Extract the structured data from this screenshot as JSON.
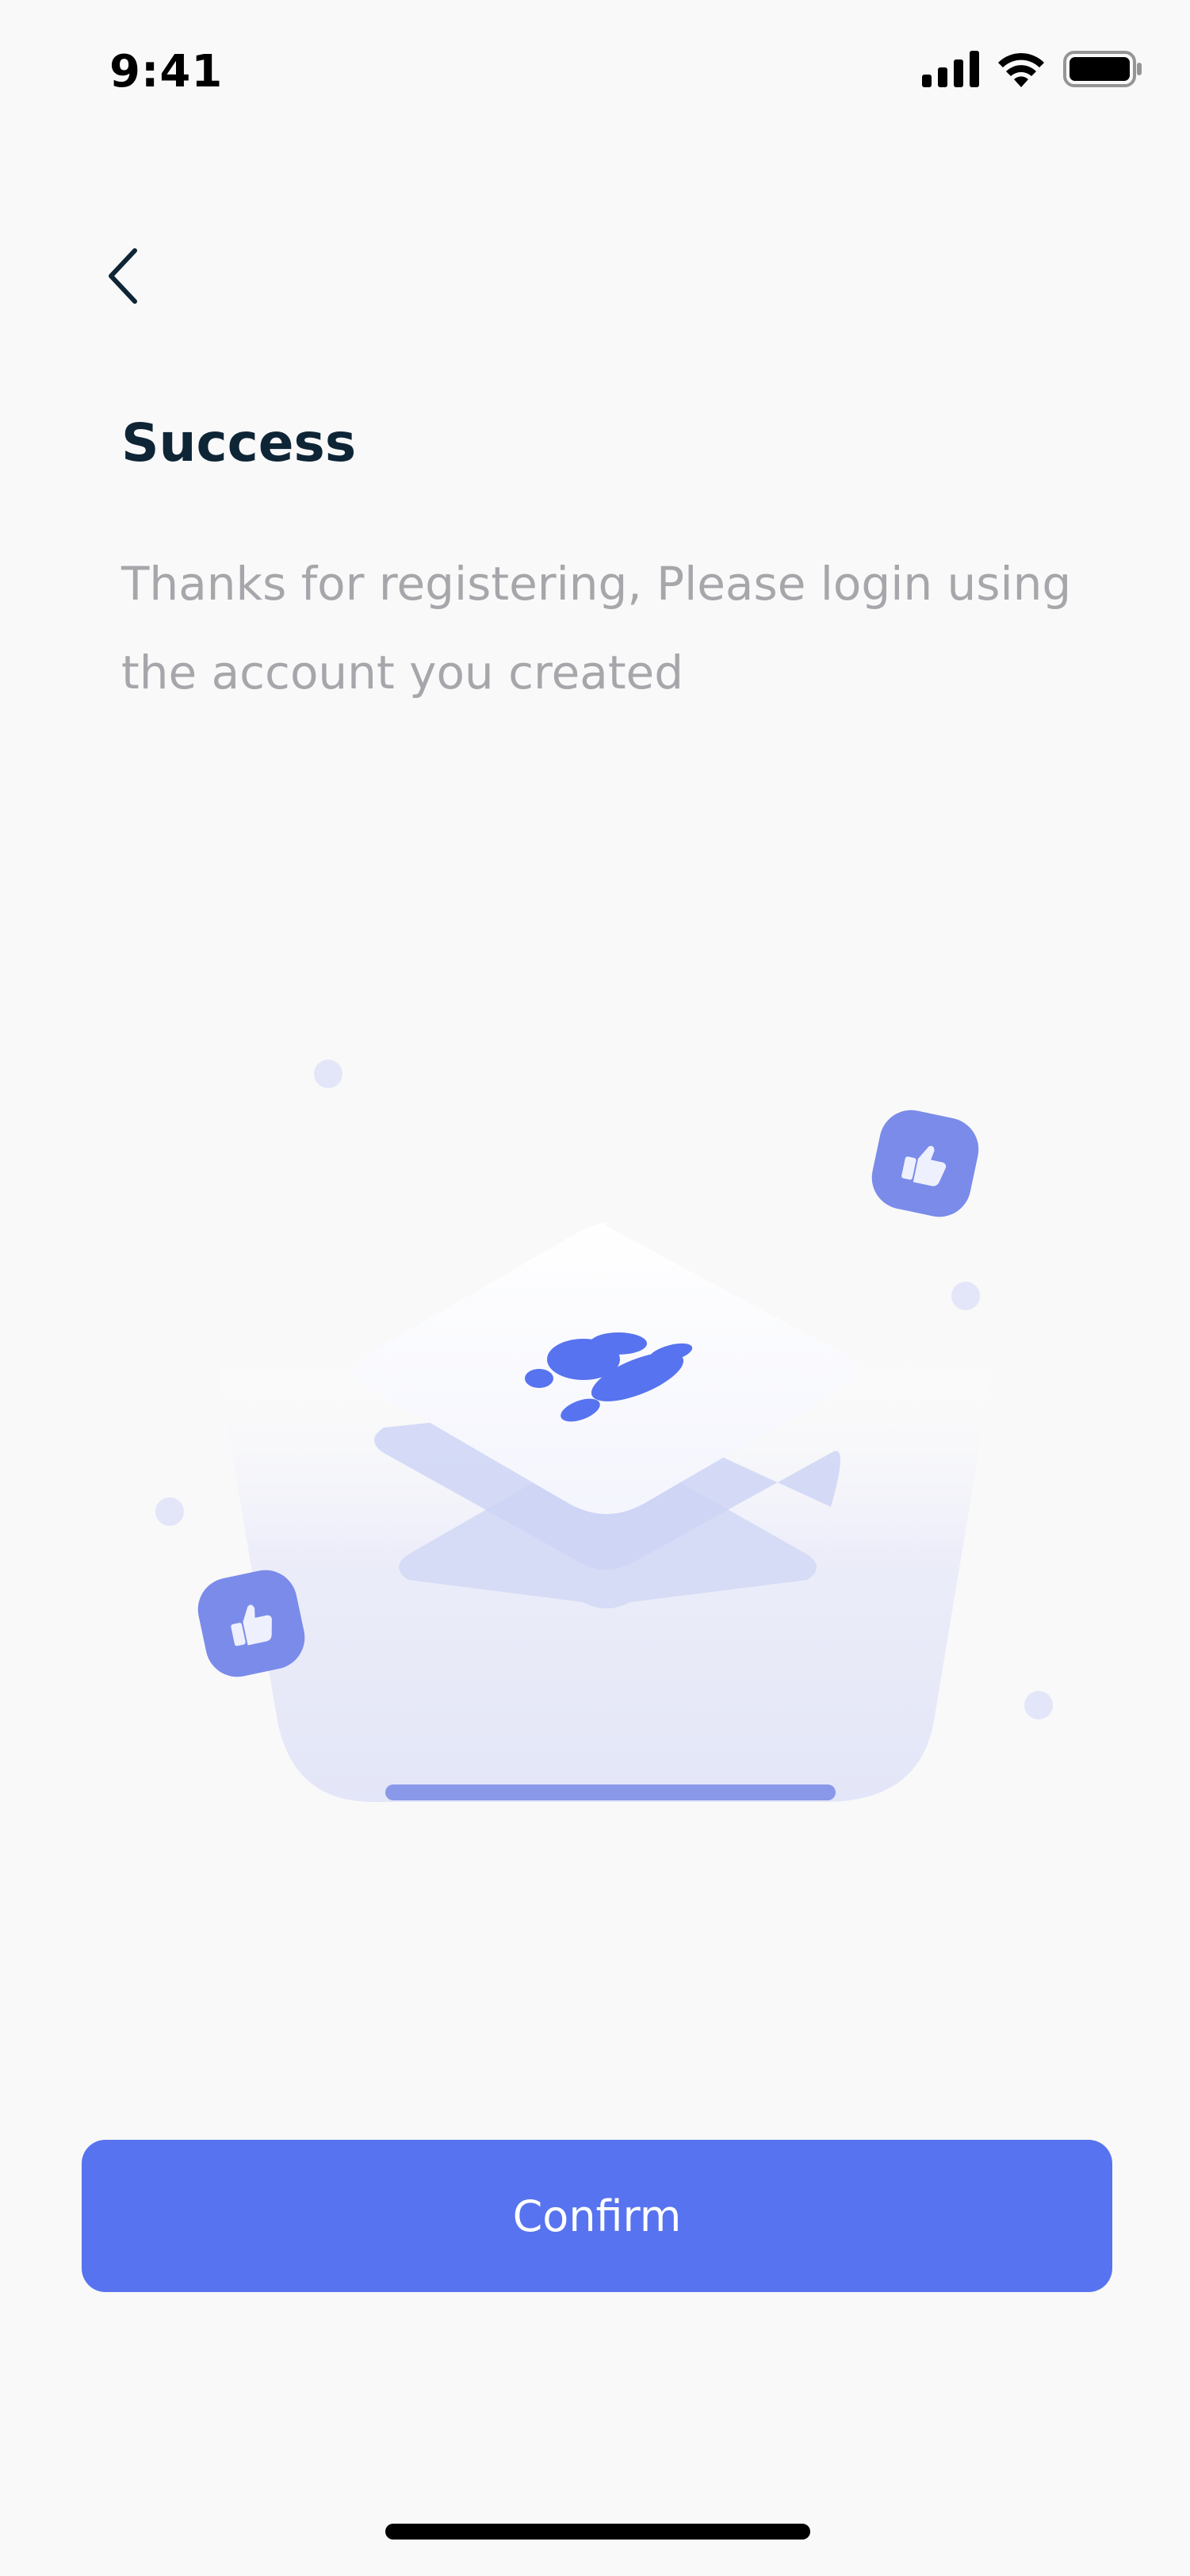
{
  "status_bar": {
    "time": "9:41",
    "icons": [
      "cellular-signal-icon",
      "wifi-icon",
      "battery-icon"
    ]
  },
  "header": {
    "back_icon": "chevron-left-icon"
  },
  "content": {
    "title": "Success",
    "message": "Thanks for registering, Please login using the account you created"
  },
  "illustration": {
    "icons": [
      "thumbs-up-icon",
      "app-logo-icon"
    ]
  },
  "actions": {
    "confirm_label": "Confirm"
  },
  "colors": {
    "accent": "#5773ef",
    "title": "#0e2536",
    "subtitle": "#a6a6ab",
    "background": "#f9f9f9"
  }
}
